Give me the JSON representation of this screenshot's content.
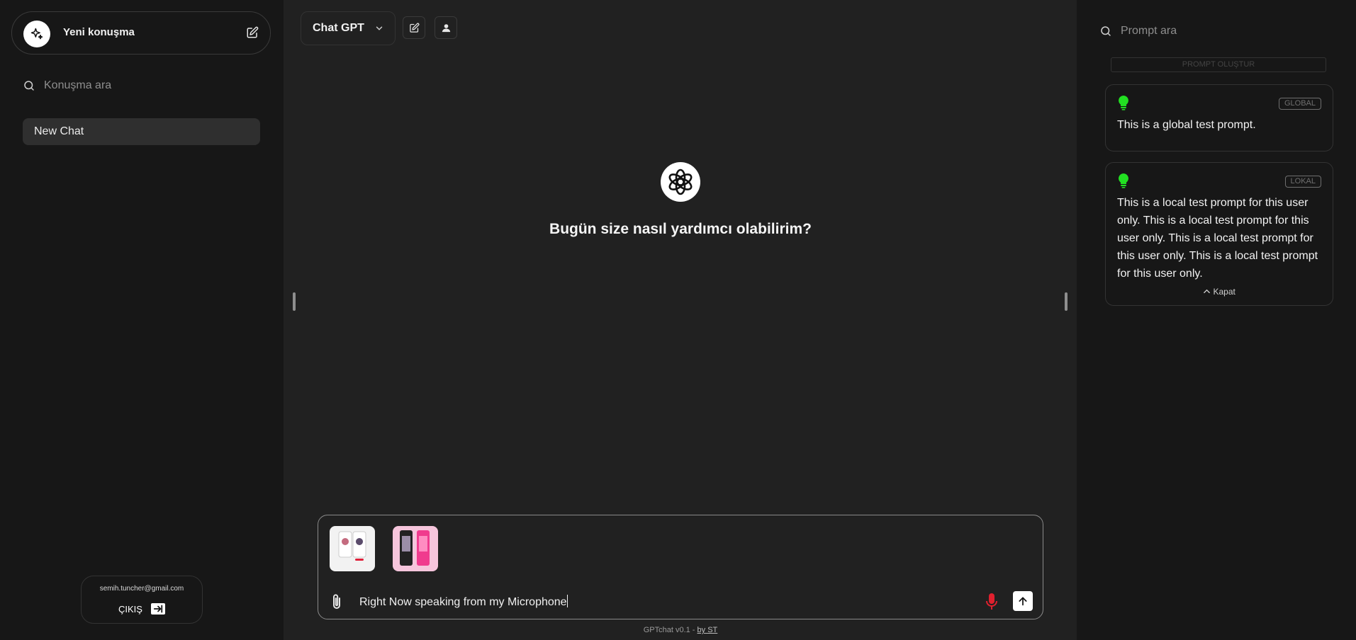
{
  "left_sidebar": {
    "new_chat_title": "Yeni konuşma",
    "search_label": "Konuşma ara",
    "chats": [
      {
        "label": "New Chat"
      }
    ],
    "user_email": "semih.tuncher@gmail.com",
    "logout_label": "ÇIKIŞ"
  },
  "topbar": {
    "model_name": "Chat GPT"
  },
  "main": {
    "headline": "Bugün size nasıl yardımcı olabilirim?"
  },
  "composer": {
    "text": "Right Now speaking from my Microphone",
    "attachments": [
      {
        "name": "Attachment 1"
      },
      {
        "name": "Attachment 2"
      }
    ]
  },
  "footer": {
    "version": "GPTchat v0.1 - ",
    "author_link": "by ST"
  },
  "right_sidebar": {
    "search_label": "Prompt ara",
    "create_label": "PROMPT OLUŞTUR",
    "prompts": [
      {
        "badge": "GLOBAL",
        "text": "This is a global test prompt."
      },
      {
        "badge": "LOKAL",
        "text": "This is a local test prompt for this user only. This is a local test prompt for this user only. This is a local test prompt for this user only. This is a local test prompt for this user only.",
        "collapse_label": "Kapat"
      }
    ]
  },
  "colors": {
    "sidebar_bg": "#171717",
    "main_bg": "#212121",
    "bulb": "#22e022",
    "mic": "#e0202e"
  }
}
